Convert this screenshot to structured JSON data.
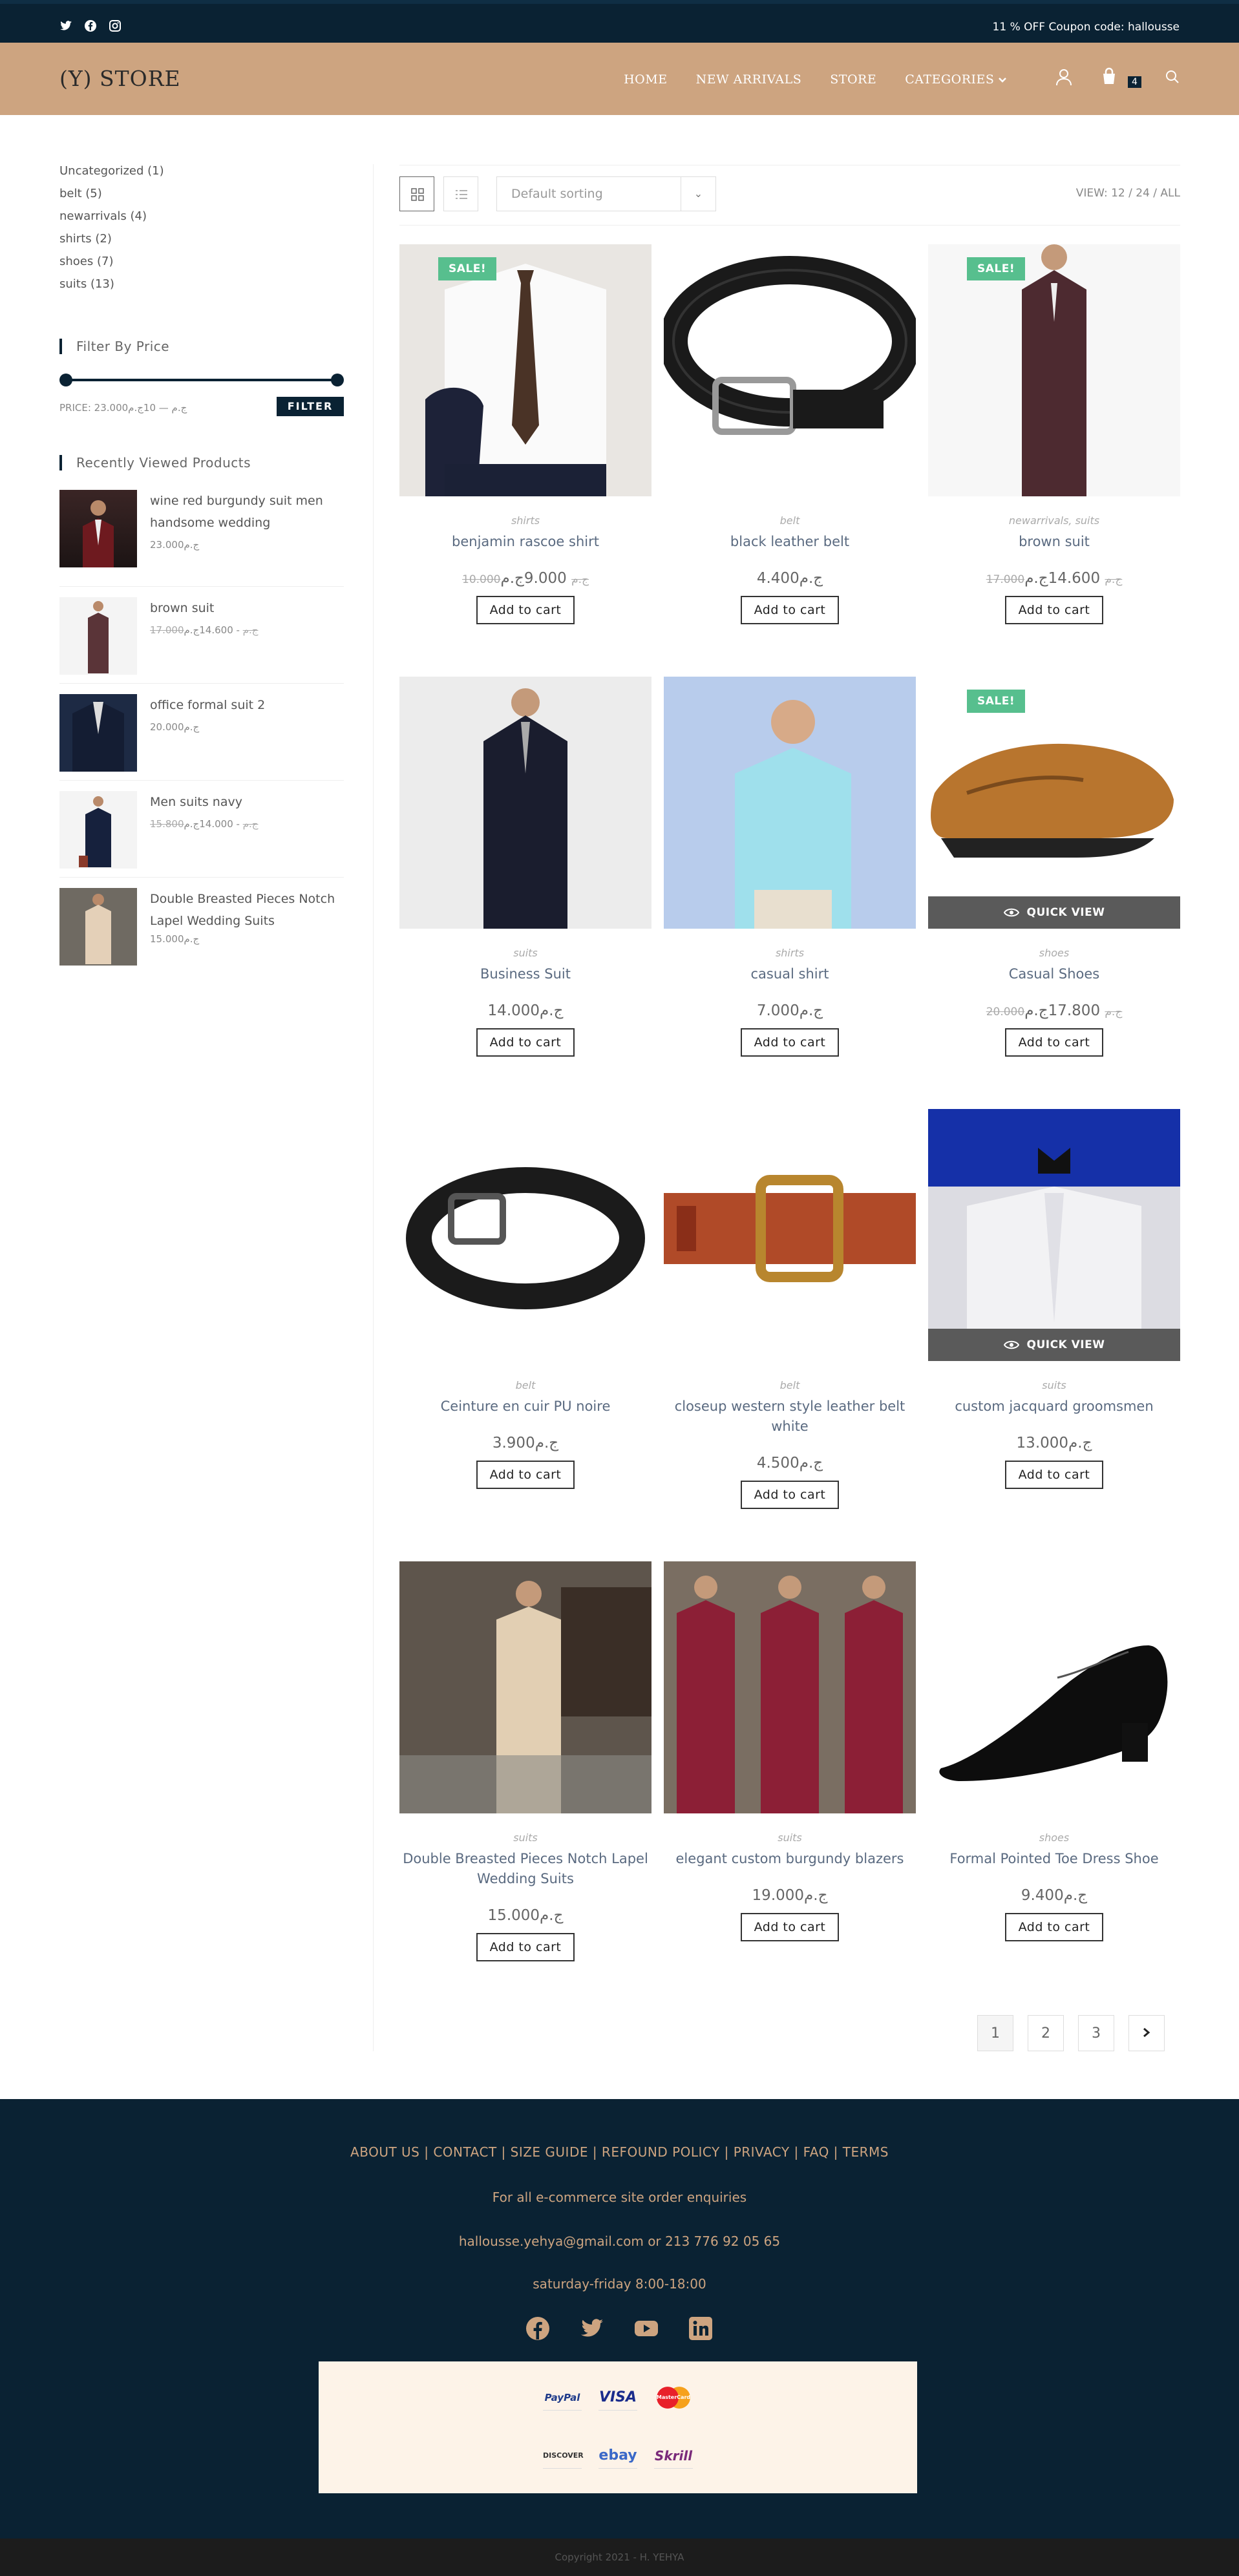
{
  "topbar": {
    "coupon": "11 % OFF Coupon code: hallousse",
    "social": [
      "twitter-icon",
      "facebook-icon",
      "instagram-icon"
    ]
  },
  "header": {
    "logo": "(Y) STORE",
    "nav": [
      "HOME",
      "NEW ARRIVALS",
      "STORE",
      "CATEGORIES"
    ],
    "cart_count": "4"
  },
  "sidebar": {
    "categories": [
      "Uncategorized (1)",
      "belt (5)",
      "newarrivals (4)",
      "shirts (2)",
      "shoes (7)",
      "suits (13)"
    ],
    "filter_title": "Filter By Price",
    "price_text": "PRICE: 23.000ج.م — 10ج.م",
    "filter_button": "FILTER",
    "recent_title": "Recently Viewed Products",
    "recent": [
      {
        "name": "wine red burgundy suit men handsome wedding",
        "price": "23.000ج.م",
        "old": ""
      },
      {
        "name": "brown suit",
        "price": "14.600ج.م",
        "old": "17.000ج.م"
      },
      {
        "name": "office formal suit 2",
        "price": "20.000ج.م",
        "old": ""
      },
      {
        "name": "Men suits navy",
        "price": "14.000ج.م",
        "old": "15.800ج.م"
      },
      {
        "name": "Double Breasted Pieces Notch Lapel Wedding Suits",
        "price": "15.000ج.م",
        "old": ""
      }
    ]
  },
  "toolbar": {
    "sort": "Default sorting",
    "view_label": "VIEW:",
    "view_opts": "12 / 24 / ALL"
  },
  "products": [
    {
      "cat": "shirts",
      "title": "benjamin rascoe shirt",
      "price": "9.000ج.م",
      "old": "10.000ج.م",
      "sale": "SALE!",
      "qv": ""
    },
    {
      "cat": "belt",
      "title": "black leather belt",
      "price": "4.400ج.م",
      "old": "",
      "sale": "",
      "qv": ""
    },
    {
      "cat": "newarrivals, suits",
      "title": "brown suit",
      "price": "14.600ج.م",
      "old": "17.000ج.م",
      "sale": "SALE!",
      "qv": ""
    },
    {
      "cat": "suits",
      "title": "Business Suit",
      "price": "14.000ج.م",
      "old": "",
      "sale": "",
      "qv": ""
    },
    {
      "cat": "shirts",
      "title": "casual shirt",
      "price": "7.000ج.م",
      "old": "",
      "sale": "",
      "qv": ""
    },
    {
      "cat": "shoes",
      "title": "Casual Shoes",
      "price": "17.800ج.م",
      "old": "20.000ج.م",
      "sale": "SALE!",
      "qv": "QUICK VIEW"
    },
    {
      "cat": "belt",
      "title": "Ceinture en cuir PU noire",
      "price": "3.900ج.م",
      "old": "",
      "sale": "",
      "qv": ""
    },
    {
      "cat": "belt",
      "title": "closeup western style leather belt white",
      "price": "4.500ج.م",
      "old": "",
      "sale": "",
      "qv": ""
    },
    {
      "cat": "suits",
      "title": "custom jacquard groomsmen",
      "price": "13.000ج.م",
      "old": "",
      "sale": "",
      "qv": "QUICK VIEW"
    },
    {
      "cat": "suits",
      "title": "Double Breasted Pieces Notch Lapel Wedding Suits",
      "price": "15.000ج.م",
      "old": "",
      "sale": "",
      "qv": ""
    },
    {
      "cat": "suits",
      "title": "elegant custom burgundy blazers",
      "price": "19.000ج.م",
      "old": "",
      "sale": "",
      "qv": ""
    },
    {
      "cat": "shoes",
      "title": "Formal Pointed Toe Dress Shoe",
      "price": "9.400ج.م",
      "old": "",
      "sale": "",
      "qv": ""
    }
  ],
  "add_to_cart": "Add to cart",
  "pager": [
    "1",
    "2",
    "3"
  ],
  "footer": {
    "links": "ABOUT US | CONTACT | SIZE GUIDE | REFOUND POLICY | PRIVACY | FAQ | TERMS",
    "enquiries": "For all e-commerce site order enquiries",
    "contact": "hallousse.yehya@gmail.com or  213 776 92 05 65",
    "hours": "saturday-friday 8:00-18:00",
    "payments": [
      "PayPal",
      "VISA",
      "MasterCard",
      "DISCOVER",
      "ebay",
      "Skrill"
    ]
  },
  "copyright": "Copyright 2021 - H. YEHYA",
  "colors": {
    "accent": "#cda480",
    "dark": "#0a2233",
    "sale": "#57bf8e"
  }
}
